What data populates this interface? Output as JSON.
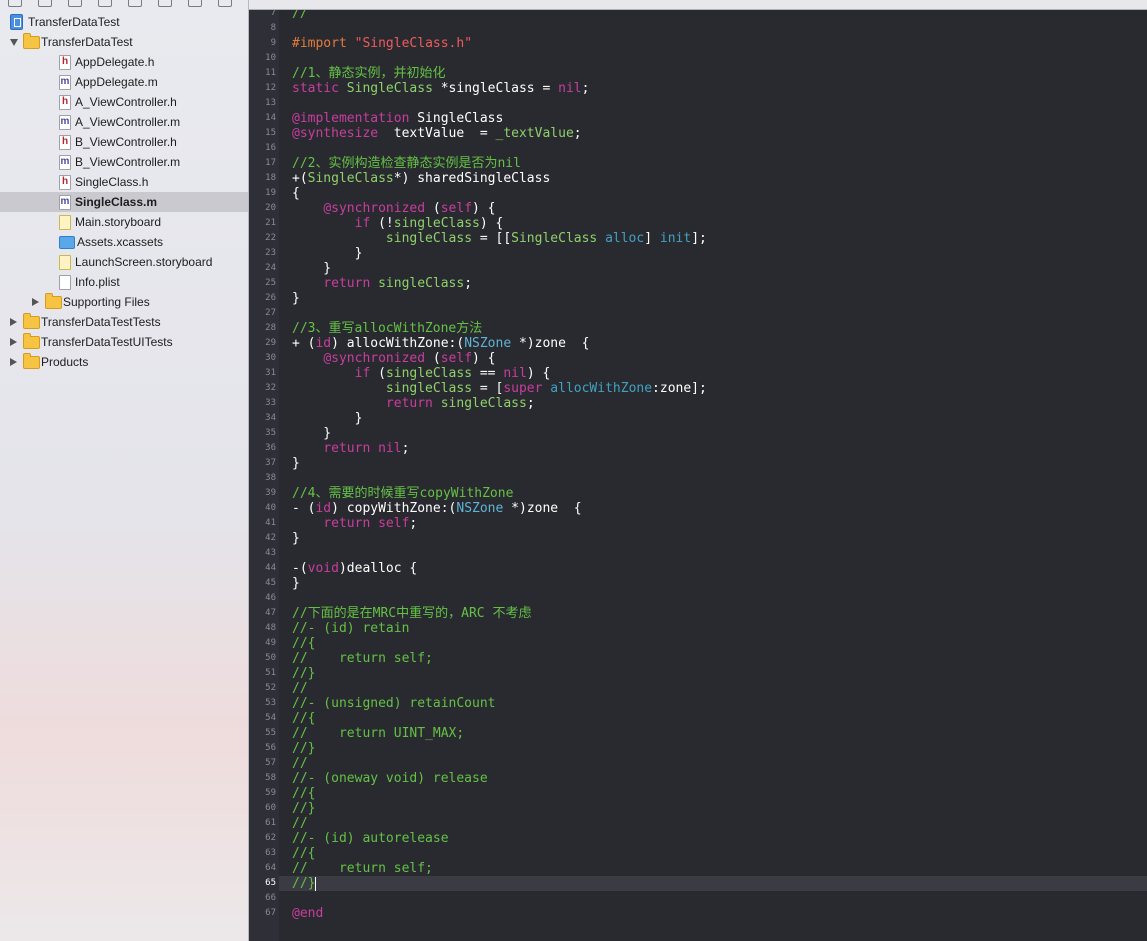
{
  "navigator": {
    "items": [
      {
        "label": "TransferDataTest",
        "icon": "project-icon",
        "depth": 0,
        "disclosure": "none"
      },
      {
        "label": "TransferDataTest",
        "icon": "folder-icon",
        "depth": 0,
        "disclosure": "open"
      },
      {
        "label": "AppDelegate.h",
        "icon": "header-file-icon",
        "depth": 2,
        "disclosure": "none"
      },
      {
        "label": "AppDelegate.m",
        "icon": "implementation-file-icon",
        "depth": 2,
        "disclosure": "none"
      },
      {
        "label": "A_ViewController.h",
        "icon": "header-file-icon",
        "depth": 2,
        "disclosure": "none"
      },
      {
        "label": "A_ViewController.m",
        "icon": "implementation-file-icon",
        "depth": 2,
        "disclosure": "none"
      },
      {
        "label": "B_ViewController.h",
        "icon": "header-file-icon",
        "depth": 2,
        "disclosure": "none"
      },
      {
        "label": "B_ViewController.m",
        "icon": "implementation-file-icon",
        "depth": 2,
        "disclosure": "none"
      },
      {
        "label": "SingleClass.h",
        "icon": "header-file-icon",
        "depth": 2,
        "disclosure": "none"
      },
      {
        "label": "SingleClass.m",
        "icon": "implementation-file-icon",
        "depth": 2,
        "disclosure": "none",
        "selected": true
      },
      {
        "label": "Main.storyboard",
        "icon": "storyboard-icon",
        "depth": 2,
        "disclosure": "none"
      },
      {
        "label": "Assets.xcassets",
        "icon": "assets-icon",
        "depth": 2,
        "disclosure": "none"
      },
      {
        "label": "LaunchScreen.storyboard",
        "icon": "storyboard-icon",
        "depth": 2,
        "disclosure": "none"
      },
      {
        "label": "Info.plist",
        "icon": "plist-icon",
        "depth": 2,
        "disclosure": "none"
      },
      {
        "label": "Supporting Files",
        "icon": "folder-icon",
        "depth": 1,
        "disclosure": "closed"
      },
      {
        "label": "TransferDataTestTests",
        "icon": "folder-icon",
        "depth": 0,
        "disclosure": "closed"
      },
      {
        "label": "TransferDataTestUITests",
        "icon": "folder-icon",
        "depth": 0,
        "disclosure": "closed"
      },
      {
        "label": "Products",
        "icon": "folder-icon",
        "depth": 0,
        "disclosure": "closed"
      }
    ]
  },
  "editor": {
    "current_line": 65,
    "lines": [
      {
        "n": 7,
        "tokens": [
          [
            "//",
            "comment"
          ]
        ]
      },
      {
        "n": 8,
        "tokens": []
      },
      {
        "n": 9,
        "tokens": [
          [
            "#import ",
            "preproc"
          ],
          [
            "\"SingleClass.h\"",
            "string"
          ]
        ]
      },
      {
        "n": 10,
        "tokens": []
      },
      {
        "n": 11,
        "tokens": [
          [
            "//1、静态实例，并初始化",
            "comment"
          ]
        ]
      },
      {
        "n": 12,
        "tokens": [
          [
            "static ",
            "keyword"
          ],
          [
            "SingleClass ",
            "project"
          ],
          [
            "*singleClass = ",
            "plain"
          ],
          [
            "nil",
            "keyword"
          ],
          [
            ";",
            "plain"
          ]
        ]
      },
      {
        "n": 13,
        "tokens": []
      },
      {
        "n": 14,
        "tokens": [
          [
            "@implementation ",
            "keyword"
          ],
          [
            "SingleClass",
            "plain"
          ]
        ]
      },
      {
        "n": 15,
        "tokens": [
          [
            "@synthesize",
            "keyword"
          ],
          [
            "  textValue  = ",
            "plain"
          ],
          [
            "_textValue",
            "project"
          ],
          [
            ";",
            "plain"
          ]
        ]
      },
      {
        "n": 16,
        "tokens": []
      },
      {
        "n": 17,
        "tokens": [
          [
            "//2、实例构造检查静态实例是否为nil",
            "comment"
          ]
        ]
      },
      {
        "n": 18,
        "tokens": [
          [
            "+(",
            "plain"
          ],
          [
            "SingleClass",
            "project"
          ],
          [
            "*) sharedSingleClass",
            "plain"
          ]
        ]
      },
      {
        "n": 19,
        "tokens": [
          [
            "{",
            "plain"
          ]
        ]
      },
      {
        "n": 20,
        "tokens": [
          [
            "    ",
            "plain"
          ],
          [
            "@synchronized",
            "keyword"
          ],
          [
            " (",
            "plain"
          ],
          [
            "self",
            "keyword"
          ],
          [
            ") {",
            "plain"
          ]
        ]
      },
      {
        "n": 21,
        "tokens": [
          [
            "        ",
            "plain"
          ],
          [
            "if",
            "keyword"
          ],
          [
            " (!",
            "plain"
          ],
          [
            "singleClass",
            "project"
          ],
          [
            ") {",
            "plain"
          ]
        ]
      },
      {
        "n": 22,
        "tokens": [
          [
            "            ",
            "plain"
          ],
          [
            "singleClass",
            "project"
          ],
          [
            " = [[",
            "plain"
          ],
          [
            "SingleClass ",
            "project"
          ],
          [
            "alloc",
            "method"
          ],
          [
            "] ",
            "plain"
          ],
          [
            "init",
            "method"
          ],
          [
            "];",
            "plain"
          ]
        ]
      },
      {
        "n": 23,
        "tokens": [
          [
            "        }",
            "plain"
          ]
        ]
      },
      {
        "n": 24,
        "tokens": [
          [
            "    }",
            "plain"
          ]
        ]
      },
      {
        "n": 25,
        "tokens": [
          [
            "    ",
            "plain"
          ],
          [
            "return ",
            "keyword"
          ],
          [
            "singleClass",
            "project"
          ],
          [
            ";",
            "plain"
          ]
        ]
      },
      {
        "n": 26,
        "tokens": [
          [
            "}",
            "plain"
          ]
        ]
      },
      {
        "n": 27,
        "tokens": []
      },
      {
        "n": 28,
        "tokens": [
          [
            "//3、重写allocWithZone方法",
            "comment"
          ]
        ]
      },
      {
        "n": 29,
        "tokens": [
          [
            "+ (",
            "plain"
          ],
          [
            "id",
            "keyword"
          ],
          [
            ") allocWithZone:(",
            "plain"
          ],
          [
            "NSZone ",
            "type"
          ],
          [
            "*)zone  {",
            "plain"
          ]
        ]
      },
      {
        "n": 30,
        "tokens": [
          [
            "    ",
            "plain"
          ],
          [
            "@synchronized",
            "keyword"
          ],
          [
            " (",
            "plain"
          ],
          [
            "self",
            "keyword"
          ],
          [
            ") {",
            "plain"
          ]
        ]
      },
      {
        "n": 31,
        "tokens": [
          [
            "        ",
            "plain"
          ],
          [
            "if",
            "keyword"
          ],
          [
            " (",
            "plain"
          ],
          [
            "singleClass",
            "project"
          ],
          [
            " == ",
            "plain"
          ],
          [
            "nil",
            "keyword"
          ],
          [
            ") {",
            "plain"
          ]
        ]
      },
      {
        "n": 32,
        "tokens": [
          [
            "            ",
            "plain"
          ],
          [
            "singleClass",
            "project"
          ],
          [
            " = [",
            "plain"
          ],
          [
            "super ",
            "keyword"
          ],
          [
            "allocWithZone",
            "method"
          ],
          [
            ":zone];",
            "plain"
          ]
        ]
      },
      {
        "n": 33,
        "tokens": [
          [
            "            ",
            "plain"
          ],
          [
            "return ",
            "keyword"
          ],
          [
            "singleClass",
            "project"
          ],
          [
            ";",
            "plain"
          ]
        ]
      },
      {
        "n": 34,
        "tokens": [
          [
            "        }",
            "plain"
          ]
        ]
      },
      {
        "n": 35,
        "tokens": [
          [
            "    }",
            "plain"
          ]
        ]
      },
      {
        "n": 36,
        "tokens": [
          [
            "    ",
            "plain"
          ],
          [
            "return ",
            "keyword"
          ],
          [
            "nil",
            "keyword"
          ],
          [
            ";",
            "plain"
          ]
        ]
      },
      {
        "n": 37,
        "tokens": [
          [
            "}",
            "plain"
          ]
        ]
      },
      {
        "n": 38,
        "tokens": []
      },
      {
        "n": 39,
        "tokens": [
          [
            "//4、需要的时候重写copyWithZone",
            "comment"
          ]
        ]
      },
      {
        "n": 40,
        "tokens": [
          [
            "- (",
            "plain"
          ],
          [
            "id",
            "keyword"
          ],
          [
            ") copyWithZone:(",
            "plain"
          ],
          [
            "NSZone ",
            "type"
          ],
          [
            "*)zone  {",
            "plain"
          ]
        ]
      },
      {
        "n": 41,
        "tokens": [
          [
            "    ",
            "plain"
          ],
          [
            "return ",
            "keyword"
          ],
          [
            "self",
            "keyword"
          ],
          [
            ";",
            "plain"
          ]
        ]
      },
      {
        "n": 42,
        "tokens": [
          [
            "}",
            "plain"
          ]
        ]
      },
      {
        "n": 43,
        "tokens": []
      },
      {
        "n": 44,
        "tokens": [
          [
            "-(",
            "plain"
          ],
          [
            "void",
            "keyword"
          ],
          [
            ")dealloc {",
            "plain"
          ]
        ]
      },
      {
        "n": 45,
        "tokens": [
          [
            "}",
            "plain"
          ]
        ]
      },
      {
        "n": 46,
        "tokens": []
      },
      {
        "n": 47,
        "tokens": [
          [
            "//下面的是在MRC中重写的，ARC 不考虑",
            "comment"
          ]
        ]
      },
      {
        "n": 48,
        "tokens": [
          [
            "//- (id) retain",
            "comment"
          ]
        ]
      },
      {
        "n": 49,
        "tokens": [
          [
            "//{",
            "comment"
          ]
        ]
      },
      {
        "n": 50,
        "tokens": [
          [
            "//    return self;",
            "comment"
          ]
        ]
      },
      {
        "n": 51,
        "tokens": [
          [
            "//}",
            "comment"
          ]
        ]
      },
      {
        "n": 52,
        "tokens": [
          [
            "//",
            "comment"
          ]
        ]
      },
      {
        "n": 53,
        "tokens": [
          [
            "//- (unsigned) retainCount",
            "comment"
          ]
        ]
      },
      {
        "n": 54,
        "tokens": [
          [
            "//{",
            "comment"
          ]
        ]
      },
      {
        "n": 55,
        "tokens": [
          [
            "//    return UINT_MAX;",
            "comment"
          ]
        ]
      },
      {
        "n": 56,
        "tokens": [
          [
            "//}",
            "comment"
          ]
        ]
      },
      {
        "n": 57,
        "tokens": [
          [
            "//",
            "comment"
          ]
        ]
      },
      {
        "n": 58,
        "tokens": [
          [
            "//- (oneway void) release",
            "comment"
          ]
        ]
      },
      {
        "n": 59,
        "tokens": [
          [
            "//{",
            "comment"
          ]
        ]
      },
      {
        "n": 60,
        "tokens": [
          [
            "//}",
            "comment"
          ]
        ]
      },
      {
        "n": 61,
        "tokens": [
          [
            "//",
            "comment"
          ]
        ]
      },
      {
        "n": 62,
        "tokens": [
          [
            "//- (id) autorelease",
            "comment"
          ]
        ]
      },
      {
        "n": 63,
        "tokens": [
          [
            "//{",
            "comment"
          ]
        ]
      },
      {
        "n": 64,
        "tokens": [
          [
            "//    return self;",
            "comment"
          ]
        ]
      },
      {
        "n": 65,
        "tokens": [
          [
            "//}",
            "comment"
          ]
        ]
      },
      {
        "n": 66,
        "tokens": []
      },
      {
        "n": 67,
        "tokens": [
          [
            "@end",
            "keyword"
          ]
        ]
      }
    ]
  }
}
